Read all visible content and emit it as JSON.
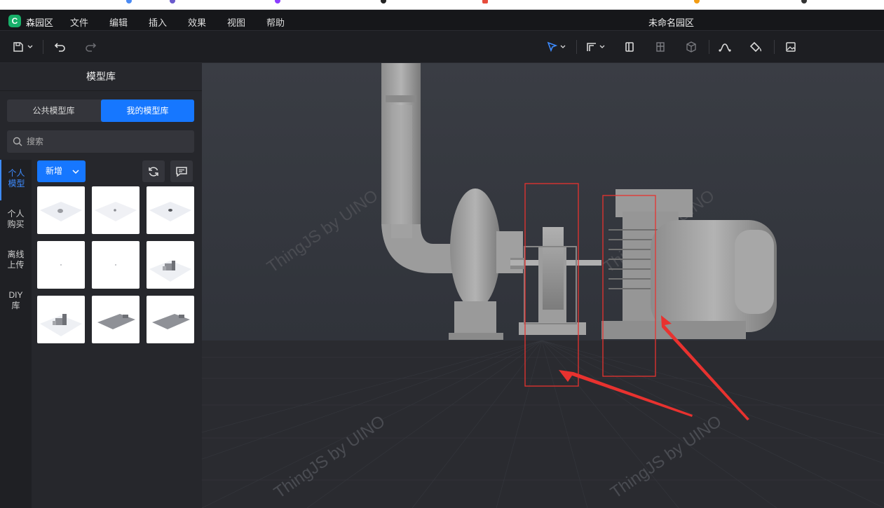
{
  "menubar": {
    "app_name": "森园区",
    "items": [
      "文件",
      "编辑",
      "插入",
      "效果",
      "视图",
      "帮助"
    ],
    "doc_title": "未命名园区"
  },
  "sidebar": {
    "title": "模型库",
    "segments": [
      "公共模型库",
      "我的模型库"
    ],
    "active_segment": "我的模型库",
    "search_placeholder": "搜索",
    "vtabs": [
      "个人模型",
      "个人购买",
      "离线上传",
      "DIY库"
    ],
    "vtab_lines": [
      [
        "个人",
        "模型"
      ],
      [
        "个人",
        "购买"
      ],
      [
        "离线",
        "上传"
      ],
      [
        "DIY",
        "库"
      ]
    ],
    "active_vtab": "个人模型",
    "new_button": "新增"
  },
  "viewport": {
    "watermark": "ThingJS by UINO"
  },
  "colors": {
    "accent": "#1677ff",
    "annotation": "#e8322f",
    "logo": "#18b06a"
  }
}
